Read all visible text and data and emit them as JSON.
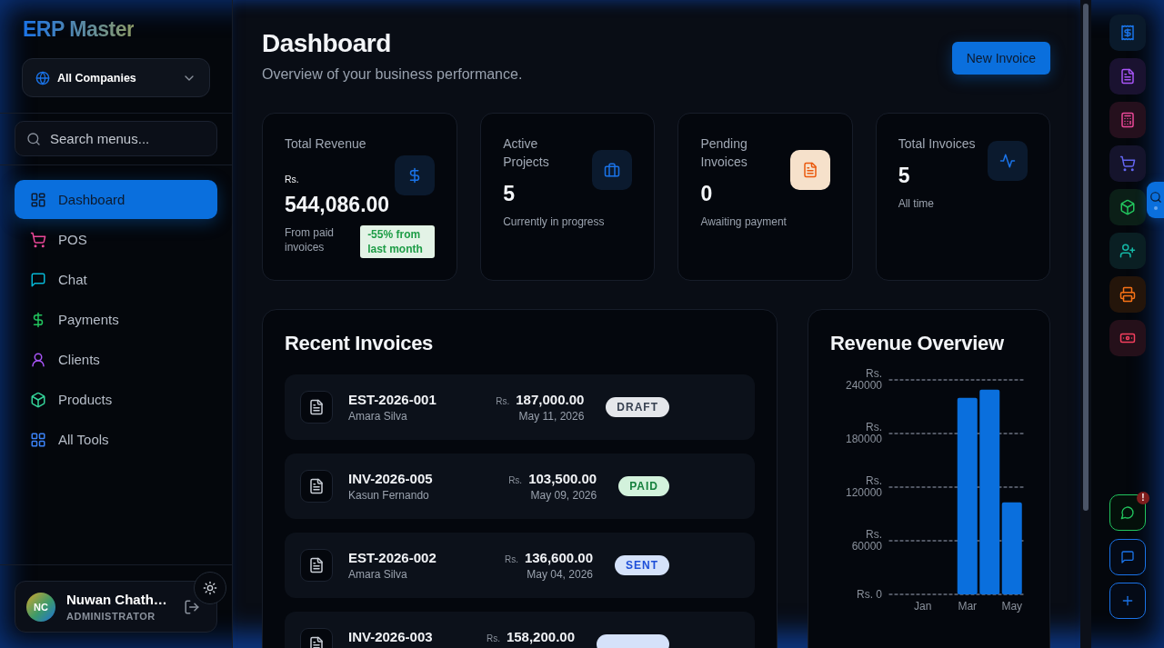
{
  "sidebar": {
    "logo": "ERP Master",
    "company_select": {
      "value": "All Companies"
    },
    "search": {
      "placeholder": "Search menus..."
    },
    "nav": [
      {
        "kind": "dashboard",
        "label": "Dashboard",
        "selected": true
      },
      {
        "kind": "pos",
        "label": "POS",
        "selected": false
      },
      {
        "kind": "chat",
        "label": "Chat",
        "selected": false
      },
      {
        "kind": "payments",
        "label": "Payments",
        "selected": false
      },
      {
        "kind": "clients",
        "label": "Clients",
        "selected": false
      },
      {
        "kind": "products",
        "label": "Products",
        "selected": false
      },
      {
        "kind": "tools",
        "label": "All Tools",
        "selected": false
      }
    ],
    "user": {
      "initials": "NC",
      "name": "Nuwan Chath…",
      "role": "ADMINISTRATOR"
    }
  },
  "header": {
    "title": "Dashboard",
    "subtitle": "Overview of your business performance.",
    "new_invoice_button": "New Invoice"
  },
  "stats": [
    {
      "kind": "revenue",
      "title": "Total Revenue",
      "currency": "Rs.",
      "value": "544,086.00",
      "note": "From paid invoices",
      "trend": "-55% from last month"
    },
    {
      "kind": "projects",
      "title": "Active Projects",
      "value": "5",
      "note": "Currently in progress"
    },
    {
      "kind": "pending",
      "title": "Pending Invoices",
      "value": "0",
      "note": "Awaiting payment"
    },
    {
      "kind": "invoices",
      "title": "Total Invoices",
      "value": "5",
      "note": "All time"
    }
  ],
  "recent_invoices": {
    "title": "Recent Invoices",
    "rows": [
      {
        "kind": "draft",
        "number": "EST-2026-001",
        "client": "Amara Silva",
        "currency": "Rs.",
        "amount": "187,000.00",
        "date": "May 11, 2026",
        "status": "DRAFT"
      },
      {
        "kind": "paid",
        "number": "INV-2026-005",
        "client": "Kasun Fernando",
        "currency": "Rs.",
        "amount": "103,500.00",
        "date": "May 09, 2026",
        "status": "PAID"
      },
      {
        "kind": "sent",
        "number": "EST-2026-002",
        "client": "Amara Silva",
        "currency": "Rs.",
        "amount": "136,600.00",
        "date": "May 04, 2026",
        "status": "SENT"
      },
      {
        "kind": "sent",
        "number": "INV-2026-003",
        "currency": "Rs.",
        "amount": "158,200.00"
      }
    ]
  },
  "revenue_overview": {
    "title": "Revenue Overview",
    "chart_data": {
      "type": "bar",
      "categories": [
        null,
        "Jan",
        null,
        "Mar",
        null,
        "May"
      ],
      "values": [
        0,
        0,
        0,
        220000,
        229000,
        103000
      ],
      "ylim": [
        0,
        240000
      ],
      "yticks": [
        {
          "value": 0,
          "label": "Rs. 0"
        },
        {
          "value": 60000,
          "label": "Rs. 60000"
        },
        {
          "value": 120000,
          "label": "Rs. 120000"
        },
        {
          "value": 180000,
          "label": "Rs. 180000"
        },
        {
          "value": 240000,
          "label": "Rs. 240000"
        }
      ],
      "grid": true
    }
  },
  "tool_rail": {
    "tools": [
      {
        "kind": "receipt"
      },
      {
        "kind": "document"
      },
      {
        "kind": "calculator"
      },
      {
        "kind": "cart"
      },
      {
        "kind": "package"
      },
      {
        "kind": "add-user"
      },
      {
        "kind": "printer"
      },
      {
        "kind": "cash"
      }
    ],
    "chat_alert": "!"
  }
}
